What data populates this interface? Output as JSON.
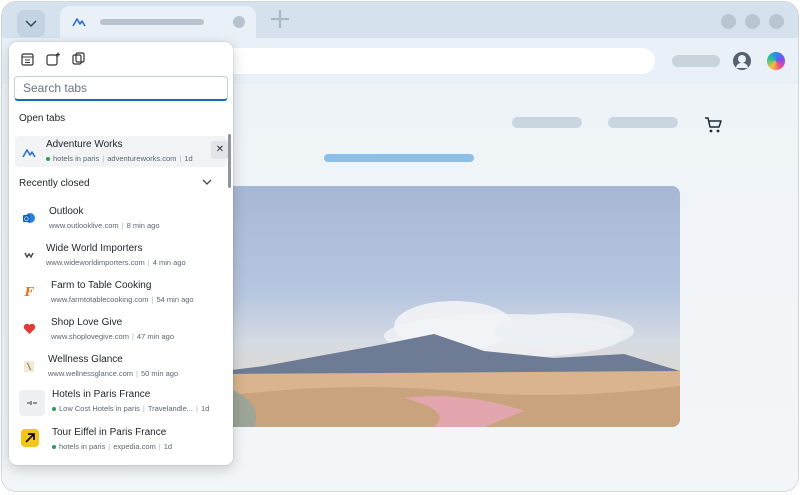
{
  "popup": {
    "search_placeholder": "Search tabs",
    "open_tabs_label": "Open tabs",
    "open_tab": {
      "title": "Adventure Works",
      "group": "hotels in paris",
      "domain": "adventureworks.com",
      "age": "1d"
    },
    "recently_closed_label": "Recently closed",
    "recently_closed": [
      {
        "title": "Outlook",
        "domain": "www.outlooklive.com",
        "age": "8 min ago",
        "icon": "outlook-icon",
        "color": "#1a73e8"
      },
      {
        "title": "Wide World Importers",
        "domain": "www.wideworldimporters.com",
        "age": "4 min ago",
        "icon": "wide-world-importers-icon",
        "color": "#444444"
      },
      {
        "title": "Farm to Table Cooking",
        "domain": "www.farmtotablecooking.com",
        "age": "54 min ago",
        "icon": "farm-to-table-icon",
        "color": "#e8711c"
      },
      {
        "title": "Shop Love Give",
        "domain": "www.shoplovegive.com",
        "age": "47 min ago",
        "icon": "heart-icon",
        "color": "#e03a3a"
      },
      {
        "title": "Wellness Glance",
        "domain": "www.wellnessglance.com",
        "age": "50 min ago",
        "icon": "wellness-icon",
        "color": "#9a8a5a"
      },
      {
        "title": "Hotels in Paris France",
        "group": "Low Cost Hotels in paris",
        "domain": "Travelandle...",
        "age": "1d",
        "icon": "hotels-icon",
        "color": "#333333"
      },
      {
        "title": "Tour Eiffel in Paris France",
        "group": "hotels in paris",
        "domain": "expedia.com",
        "age": "1d",
        "icon": "expedia-icon",
        "color": "#f5c518"
      }
    ]
  },
  "colors": {
    "accent": "#0f6cbd",
    "group_dot": "#2f9b5a",
    "hero_accent_bar": "#8cc0e9"
  }
}
